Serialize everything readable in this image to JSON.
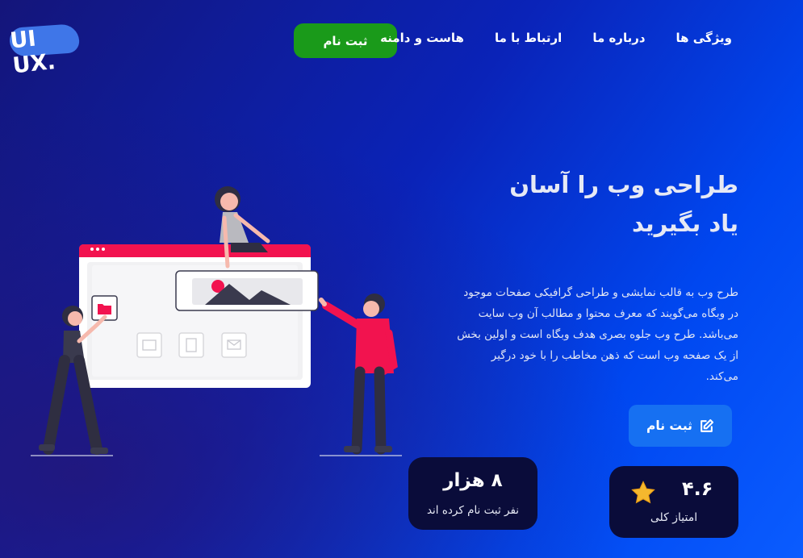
{
  "logo": {
    "text": "UI UX."
  },
  "nav": {
    "items": [
      {
        "label": "ویژگی ها"
      },
      {
        "label": "درباره ما"
      },
      {
        "label": "ارتباط با ما"
      },
      {
        "label": "هاست و دامنه"
      }
    ],
    "cta_label": "ثبت نام"
  },
  "hero": {
    "title": "طراحی وب را آسان یاد بگیرید",
    "description": "طرح وب به قالب نمایشی و طراحی گرافیکی صفحات موجود در وبگاه می‌گویند که معرف محتوا و مطالب آن وب سایت می‌باشد. طرح وب جلوه بصری هدف وبگاه است و اولین بخش از یک صفحه وب است که ذهن مخاطب را با خود درگیر می‌کند.",
    "cta_label": "ثبت نام",
    "cta_icon": "edit-icon"
  },
  "stats": {
    "users": {
      "value": "۸ هزار",
      "label": "نفر ثبت نام کرده اند"
    },
    "rating": {
      "value": "۴.۶",
      "label": "امتیاز کلی",
      "icon": "star-icon"
    }
  },
  "colors": {
    "nav_cta": "#1a9a1a",
    "hero_cta": "#1670f2",
    "card_bg": "#0a0c3a",
    "accent_pink": "#f2134f",
    "star": "#f5b82e"
  }
}
